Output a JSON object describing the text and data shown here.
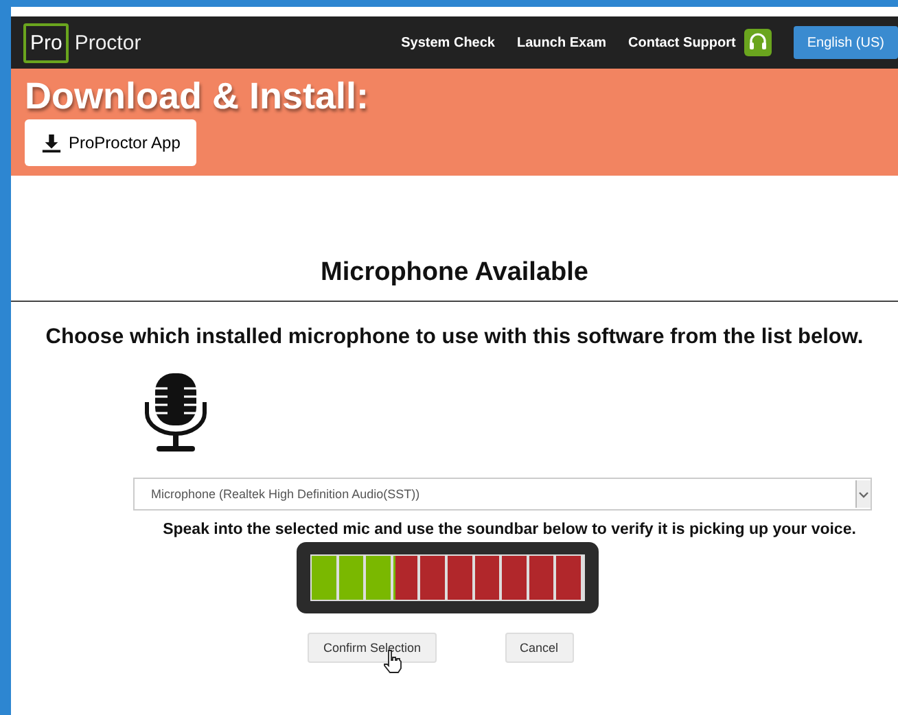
{
  "nav": {
    "logo_left": "Pro",
    "logo_right": "Proctor",
    "links": [
      "System Check",
      "Launch Exam",
      "Contact Support"
    ],
    "language": "English (US)"
  },
  "banner": {
    "title": "Download & Install:",
    "button": "ProProctor App"
  },
  "section": {
    "title": "Microphone Available",
    "instructions": "Choose which installed microphone to use with this software from the list below.",
    "select_value": "Microphone (Realtek High Definition Audio(SST))",
    "hint": "Speak into the selected mic and use the soundbar below to verify it is picking up your voice.",
    "soundbar": {
      "level": 0.31
    },
    "buttons": [
      "Confirm Selection",
      "Cancel"
    ]
  }
}
